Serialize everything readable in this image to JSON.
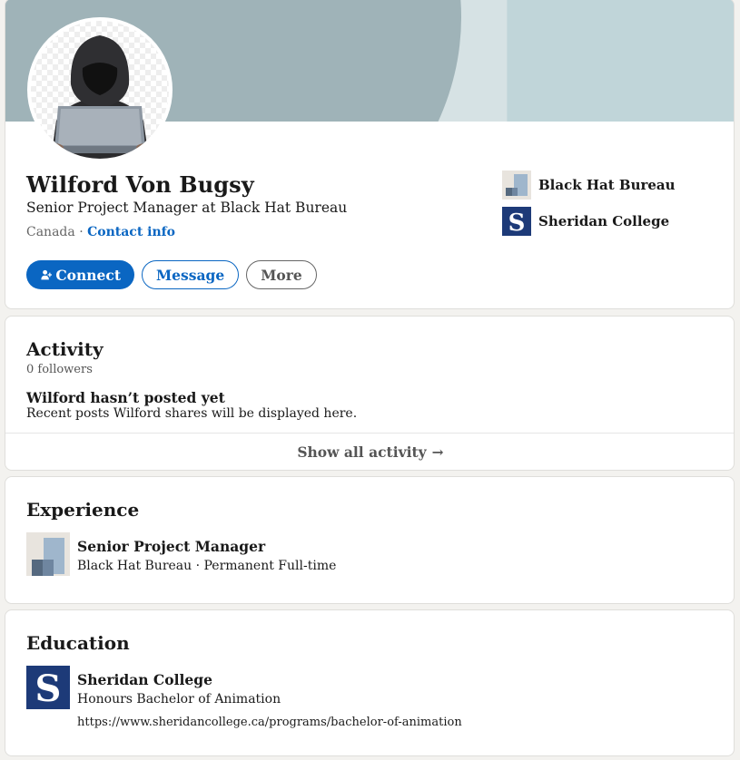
{
  "profile": {
    "name": "Wilford Von Bugsy",
    "headline": "Senior Project Manager at Black Hat Bureau",
    "location": "Canada",
    "separator": "·",
    "contact_info_label": "Contact info",
    "avatar_icon": "hooded-hacker-avatar"
  },
  "actions": {
    "connect_label": "Connect",
    "message_label": "Message",
    "more_label": "More"
  },
  "top_card_sidebar": {
    "items": [
      {
        "label": "Black Hat Bureau",
        "icon": "black-hat-bureau-logo"
      },
      {
        "label": "Sheridan College",
        "icon": "sheridan-college-logo"
      }
    ]
  },
  "activity": {
    "title": "Activity",
    "followers": "0 followers",
    "empty_title": "Wilford hasn’t posted yet",
    "empty_body": "Recent posts Wilford shares will be displayed here.",
    "show_all_label": "Show all activity",
    "show_all_arrow": "→"
  },
  "experience": {
    "title": "Experience",
    "items": [
      {
        "role": "Senior Project Manager",
        "company_line": "Black Hat Bureau · Permanent Full-time"
      }
    ]
  },
  "education": {
    "title": "Education",
    "items": [
      {
        "school": "Sheridan College",
        "degree": "Honours Bachelor of Animation",
        "link": "https://www.sheridancollege.ca/programs/bachelor-of-animation"
      }
    ]
  },
  "colors": {
    "brand_blue": "#0a66c2",
    "sheridan_navy": "#1d3a78",
    "banner_dark": "#9fb3b8",
    "banner_light": "#c0d5d9"
  }
}
